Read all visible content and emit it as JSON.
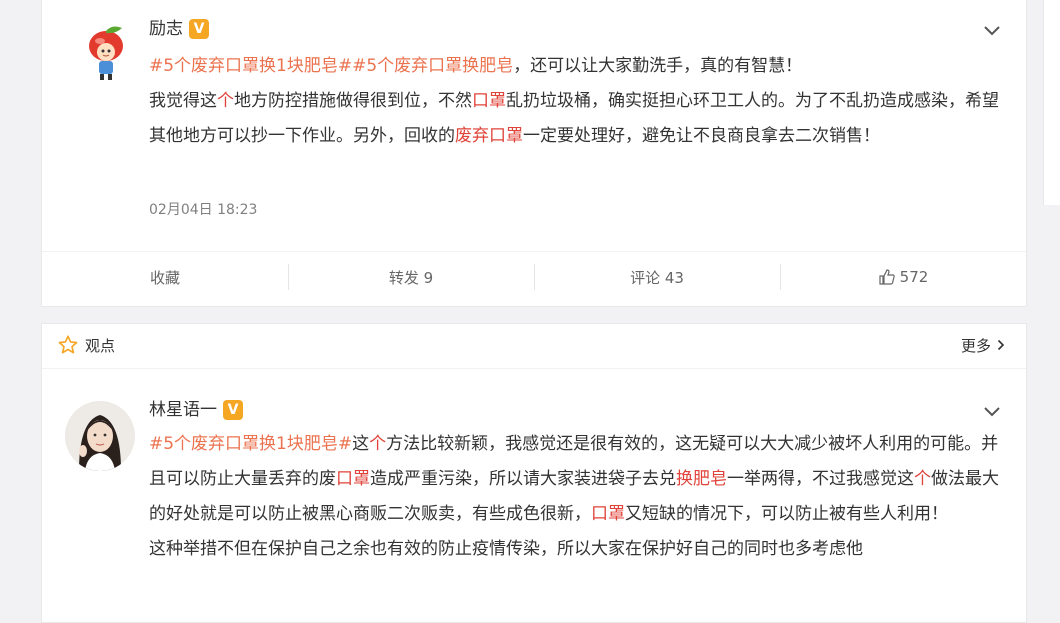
{
  "post1": {
    "author": "励志",
    "verified_badge": "V",
    "topic1": "#5个废弃口罩换1块肥皂#",
    "topic2": "#5个废弃口罩换肥皂",
    "line1_rest": "，还可以让大家勤洗手，真的有智慧！",
    "para2": [
      {
        "t": "我觉得这",
        "h": false
      },
      {
        "t": "个",
        "h": true
      },
      {
        "t": "地方防控措施做得很到位，不然",
        "h": false
      },
      {
        "t": "口罩",
        "h": true
      },
      {
        "t": "乱扔垃圾桶，确实挺担心环卫工人的。为了不乱扔造成感染，希望其他地方可以抄一下作业。另外，回收的",
        "h": false
      },
      {
        "t": "废弃口罩",
        "h": true
      },
      {
        "t": "一定要处理好，避免让不良商良拿去二次销售！",
        "h": false
      }
    ],
    "time": "02月04日 18:23",
    "actions": {
      "favorite": "收藏",
      "repost": "转发 9",
      "comment": "评论 43",
      "like": "572"
    }
  },
  "section": {
    "title": "观点",
    "more": "更多"
  },
  "post2": {
    "author": "林星语一",
    "verified_badge": "V",
    "topic": "#5个废弃口罩换1块肥皂#",
    "segments": [
      {
        "t": "这",
        "h": false
      },
      {
        "t": "个",
        "h": true
      },
      {
        "t": "方法比较新颖，我感觉还是很有效的，这无疑可以大大减少被坏人利用的可能。并且可以防止大量丢弃的废",
        "h": false
      },
      {
        "t": "口罩",
        "h": true
      },
      {
        "t": "造成严重污染，所以请大家装进袋子去兑",
        "h": false
      },
      {
        "t": "换肥皂",
        "h": true
      },
      {
        "t": "一举两得，不过我感觉这",
        "h": false
      },
      {
        "t": "个",
        "h": true
      },
      {
        "t": "做法最大的好处就是可以防止被黑心商贩二次贩卖，有些成色很新，",
        "h": false
      },
      {
        "t": "口罩",
        "h": true
      },
      {
        "t": "又短缺的情况下，可以防止被有些人利用！",
        "h": false
      }
    ],
    "para2": "这种举措不但在保护自己之余也有效的防止疫情传染，所以大家在保护好自己的同时也多考虑他"
  },
  "colors": {
    "topic": "#eb7350",
    "highlight": "#e0433a",
    "badge": "#f5a623",
    "star": "#f5a623"
  },
  "icons": [
    "chevron-down-icon",
    "like-icon",
    "star-icon",
    "chevron-right-icon"
  ]
}
